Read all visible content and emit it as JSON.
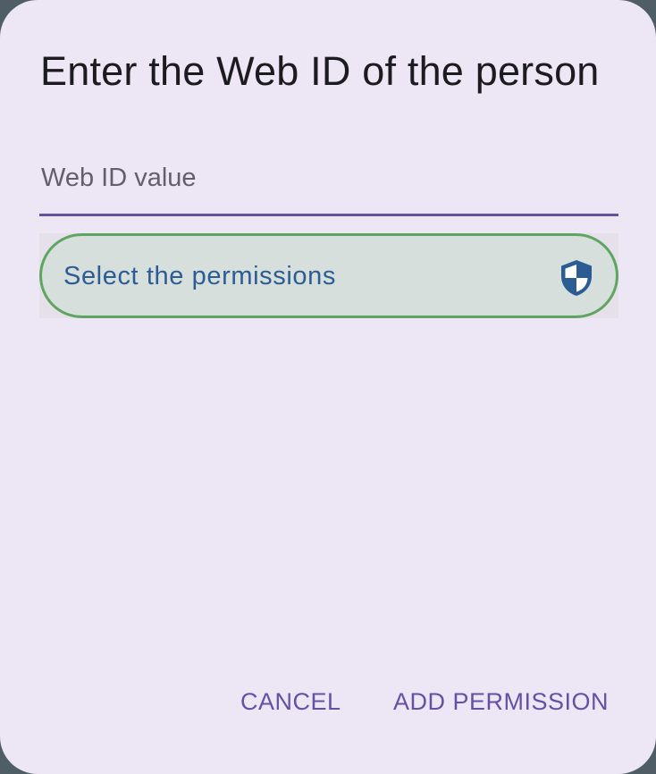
{
  "dialog": {
    "title": "Enter the Web ID of the person",
    "webid_field": {
      "placeholder": "Web ID value",
      "value": ""
    },
    "permissions_button": {
      "label": "Select the permissions",
      "icon": "shield-icon"
    },
    "actions": {
      "cancel_label": "CANCEL",
      "add_label": "ADD PERMISSION"
    }
  },
  "colors": {
    "dialog_background": "#ede7f5",
    "accent": "#6750a4",
    "permissions_border": "#5fa562",
    "permissions_fill": "#d6dfdb",
    "permissions_text": "#2c5c94"
  }
}
